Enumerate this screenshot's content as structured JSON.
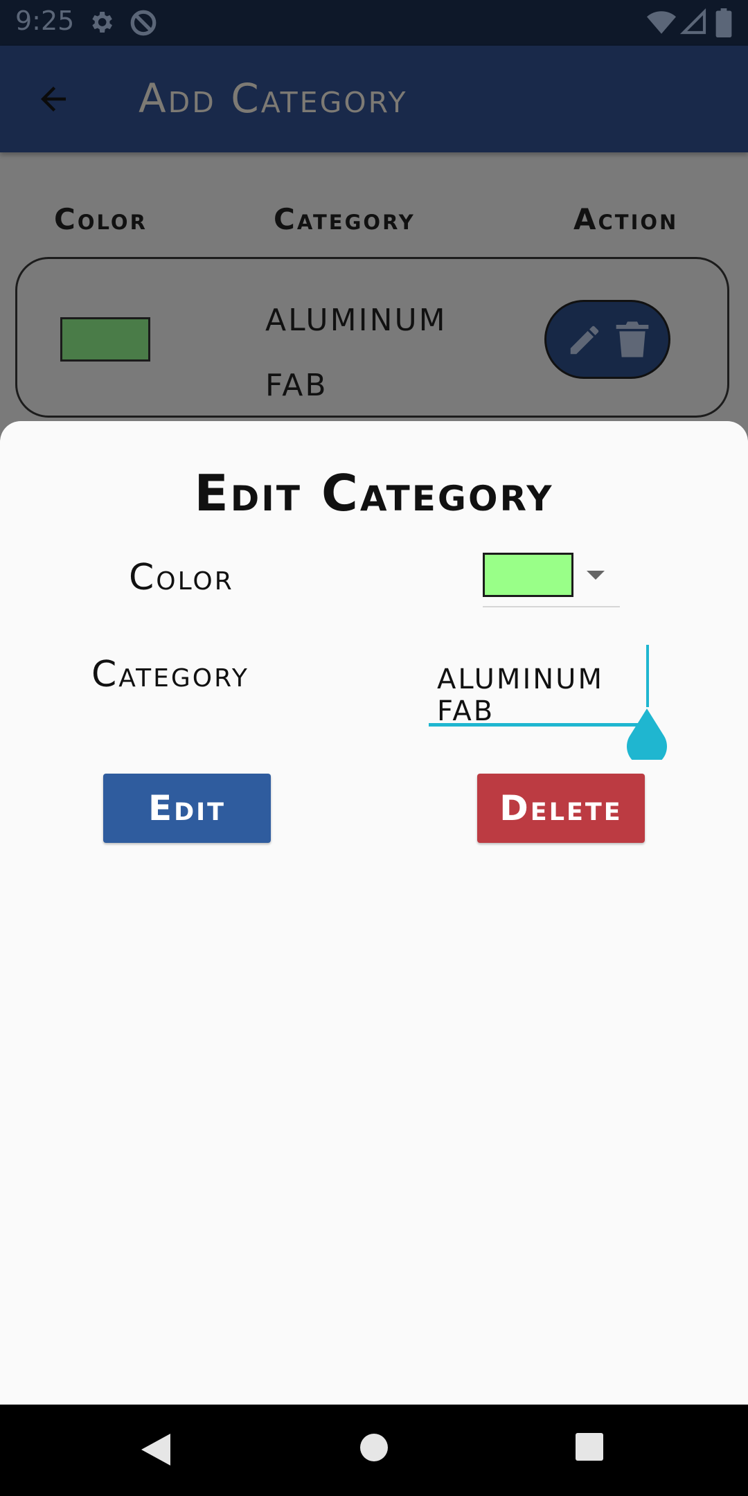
{
  "status_bar": {
    "time": "9:25"
  },
  "app_bar": {
    "title": "Add Category"
  },
  "table": {
    "headers": {
      "color": "Color",
      "category": "Category",
      "action": "Action"
    },
    "rows": [
      {
        "color": "#4a7c48",
        "name": "ALUMINUM FAB"
      }
    ]
  },
  "sheet": {
    "title": "Edit Category",
    "color_label": "Color",
    "category_label": "Category",
    "selected_color": "#99ff88",
    "category_value": "ALUMINUM FAB",
    "edit_label": "Edit",
    "delete_label": "Delete"
  },
  "colors": {
    "app_bar": "#19294a",
    "edit_button": "#2f5c9e",
    "delete_button": "#bc3b42",
    "accent": "#1fb6d0"
  },
  "icons": [
    "settings-icon",
    "do-not-disturb-icon",
    "wifi-icon",
    "cell-signal-icon",
    "battery-icon",
    "back-arrow-icon",
    "edit-pencil-icon",
    "trash-icon",
    "nav-back-icon",
    "nav-home-icon",
    "nav-recents-icon"
  ]
}
